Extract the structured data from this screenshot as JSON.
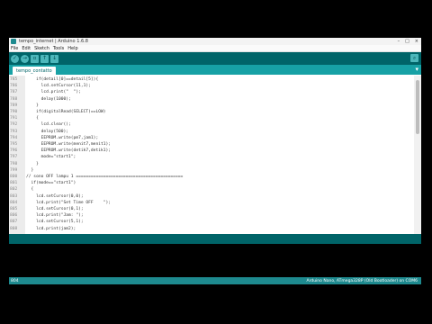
{
  "window": {
    "title": "tempo_internet | Arduino 1.6.8",
    "controls": [
      "–",
      "□",
      "×"
    ]
  },
  "menu": [
    "File",
    "Edit",
    "Sketch",
    "Tools",
    "Help"
  ],
  "toolbar": {
    "buttons": [
      {
        "name": "verify-button",
        "glyph": "✓"
      },
      {
        "name": "upload-button",
        "glyph": "→"
      },
      {
        "name": "new-button",
        "glyph": "▫"
      },
      {
        "name": "open-button",
        "glyph": "↑"
      },
      {
        "name": "save-button",
        "glyph": "↓"
      }
    ],
    "serial_glyph": "⌕"
  },
  "tab": {
    "label": "tempo_contatto",
    "menu_glyph": "▾"
  },
  "code_lines": [
    {
      "n": "785",
      "text": "    if(detail[0]==detail[5]){"
    },
    {
      "n": "786",
      "text": "      lcd.setCursor(11,1);"
    },
    {
      "n": "787",
      "text": "      lcd.print(\"  \");"
    },
    {
      "n": "788",
      "text": "      delay(1000);"
    },
    {
      "n": "789",
      "text": "    }"
    },
    {
      "n": "790",
      "text": "    if(digitalRead(SELECT)==LOW)"
    },
    {
      "n": "791",
      "text": "    {"
    },
    {
      "n": "792",
      "text": "      lcd.clear();"
    },
    {
      "n": "793",
      "text": "      delay(500);"
    },
    {
      "n": "794",
      "text": "      EEPROM.write(pm7,jam1);"
    },
    {
      "n": "795",
      "text": "      EEPROM.write(menit7,menit1);"
    },
    {
      "n": "796",
      "text": "      EEPROM.write(detik7,detik1);"
    },
    {
      "n": "797",
      "text": "      mode=\"start1\";"
    },
    {
      "n": "798",
      "text": "    }"
    },
    {
      "n": "799",
      "text": "  }"
    },
    {
      "n": "800",
      "text": "// sono OFF lampu 1 ==========================================="
    },
    {
      "n": "801",
      "text": "  if(mode==\"start1\")"
    },
    {
      "n": "802",
      "text": "  {"
    },
    {
      "n": "803",
      "text": "    lcd.setCursor(0,0);"
    },
    {
      "n": "804",
      "text": "    lcd.print(\"Set Time OFF    \");"
    },
    {
      "n": "805",
      "text": "    lcd.setCursor(0,1);"
    },
    {
      "n": "806",
      "text": "    lcd.print(\"Jam: \");"
    },
    {
      "n": "807",
      "text": "    lcd.setCursor(5,1);"
    },
    {
      "n": "808",
      "text": "    lcd.print(jam2);"
    }
  ],
  "status": {
    "left": "804",
    "right": "Arduino Nano, ATmega328P (Old Bootloader) on COM6"
  }
}
